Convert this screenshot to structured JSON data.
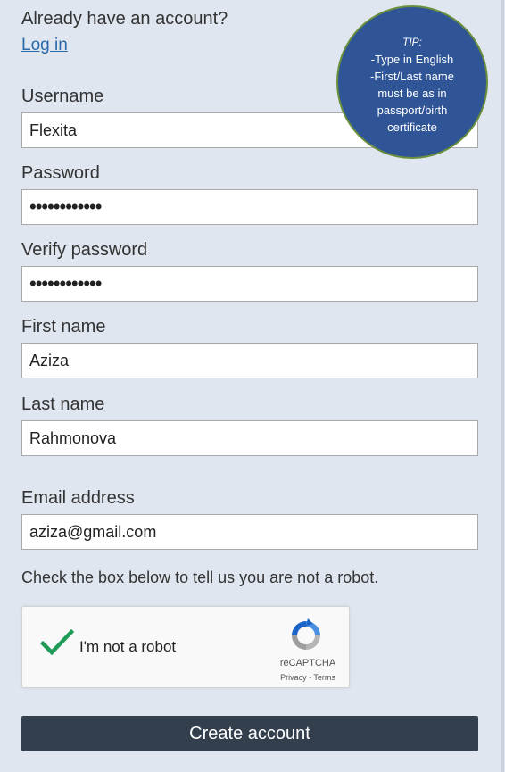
{
  "login": {
    "prompt": "Already have an account?",
    "link": "Log in"
  },
  "tip": {
    "title": "TIP:",
    "lines": [
      "-Type in English",
      "-First/Last name",
      "must be as in",
      "passport/birth",
      "certificate"
    ],
    "background_color": "#2f5597"
  },
  "form": {
    "username": {
      "label": "Username",
      "value": "Flexita"
    },
    "password": {
      "label": "Password",
      "value": "••••••••••••"
    },
    "verify_password": {
      "label": "Verify password",
      "value": "••••••••••••"
    },
    "first_name": {
      "label": "First name",
      "value": "Aziza"
    },
    "last_name": {
      "label": "Last name",
      "value": "Rahmonova"
    },
    "email": {
      "label": "Email address",
      "value": "aziza@gmail.com"
    }
  },
  "captcha": {
    "instruction": "Check the box below to tell us you are not a robot.",
    "checkbox_label": "I'm not a robot",
    "brand": "reCAPTCHA",
    "privacy": "Privacy",
    "separator": " - ",
    "terms": "Terms",
    "checked": true,
    "check_color": "#1e9b57"
  },
  "submit": {
    "label": "Create account",
    "color": "#333f4c"
  }
}
